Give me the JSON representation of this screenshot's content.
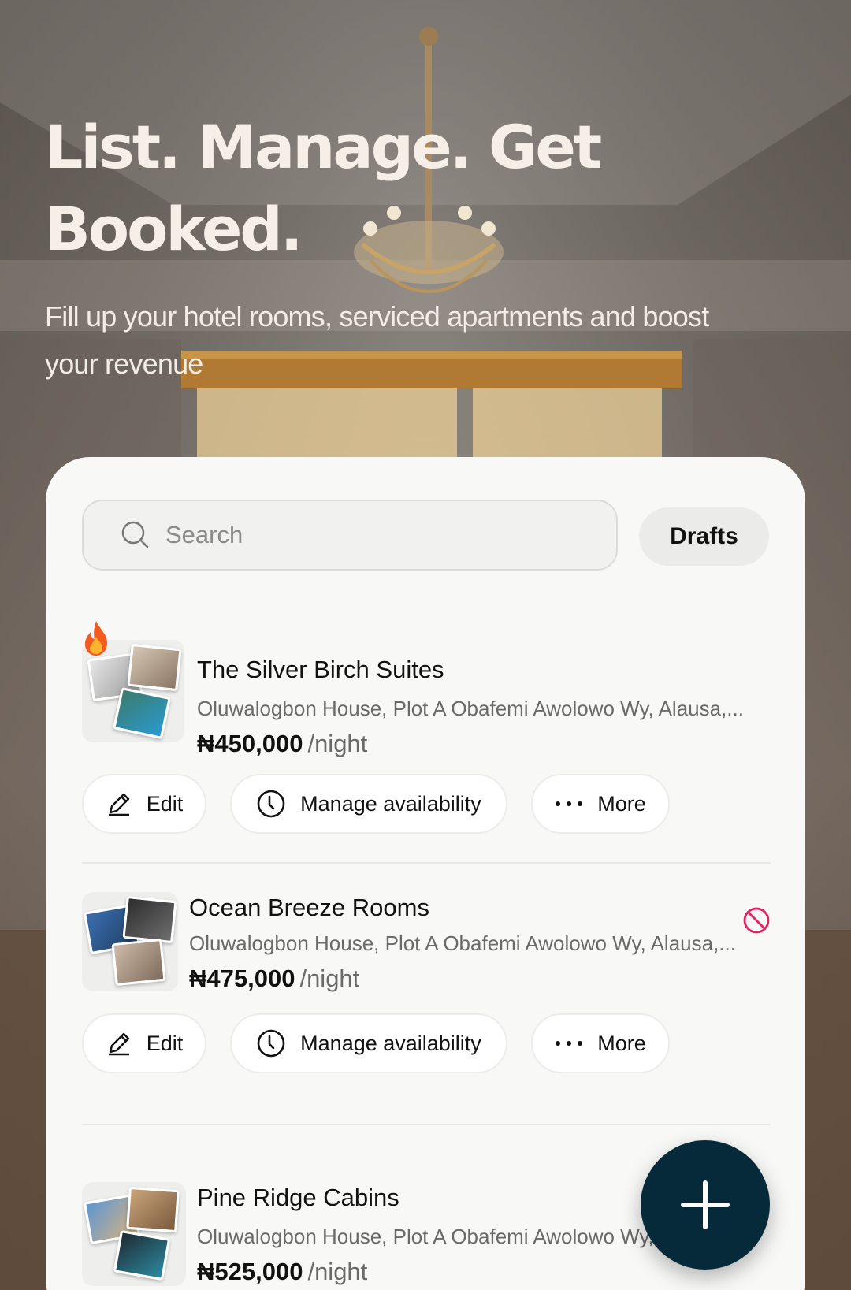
{
  "hero": {
    "title": "List. Manage. Get Booked.",
    "subtitle": "Fill up your hotel rooms, serviced apartments and boost your revenue"
  },
  "search": {
    "placeholder": "Search"
  },
  "drafts_label": "Drafts",
  "listings": [
    {
      "title": "The Silver Birch Suites",
      "address": "Oluwalogbon House, Plot A Obafemi Awolowo Wy, Alausa,...",
      "price": "₦450,000",
      "per": "/night",
      "hot": true,
      "disabled": false
    },
    {
      "title": "Ocean Breeze Rooms",
      "address": "Oluwalogbon House, Plot A Obafemi Awolowo Wy, Alausa,...",
      "price": "₦475,000",
      "per": "/night",
      "hot": false,
      "disabled": true
    },
    {
      "title": "Pine Ridge Cabins",
      "address": "Oluwalogbon House, Plot A Obafemi Awolowo Wy, Alausa,...",
      "price": "₦525,000",
      "per": "/night",
      "hot": false,
      "disabled": false
    }
  ],
  "actions": {
    "edit": "Edit",
    "availability": "Manage availability",
    "more": "More"
  },
  "icons": {
    "search": "search-icon",
    "edit": "pencil-icon",
    "availability": "clock-icon",
    "more": "ellipsis-icon",
    "hot": "fire-icon",
    "disabled": "ban-icon",
    "fab": "plus-icon"
  },
  "colors": {
    "fab": "#062a3a",
    "ban": "#e0245e",
    "hero_text": "#f6efe8"
  }
}
